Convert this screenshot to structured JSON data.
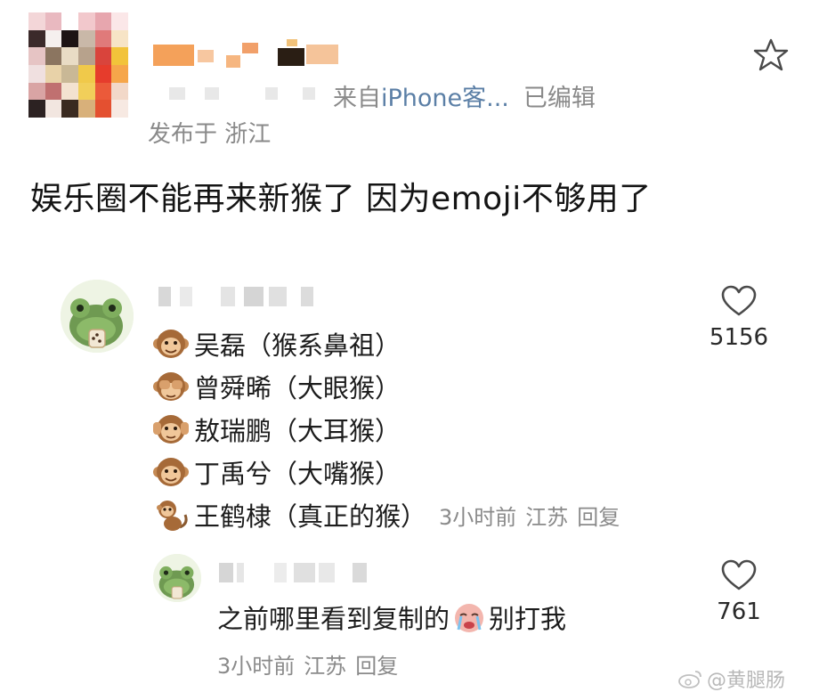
{
  "post": {
    "source_prefix": "来自",
    "source_text": "iPhone客...",
    "edited": "已编辑",
    "location": "发布于 浙江",
    "body": "娱乐圈不能再来新猴了 因为emoji不够用了",
    "star_icon": "star-outline-icon"
  },
  "comments": [
    {
      "avatar_icon": "frog-avatar-icon",
      "lines": [
        {
          "emoji": "monkey-face",
          "text": "吴磊（猴系鼻祖）"
        },
        {
          "emoji": "see-no-evil-monkey",
          "text": "曾舜晞（大眼猴）"
        },
        {
          "emoji": "hear-no-evil-monkey",
          "text": "敖瑞鹏（大耳猴）"
        },
        {
          "emoji": "monkey-face",
          "text": "丁禹兮（大嘴猴）"
        },
        {
          "emoji": "monkey",
          "text": "王鹤棣（真正的猴）"
        }
      ],
      "time": "3小时前",
      "region": "江苏",
      "reply_label": "回复",
      "likes": "5156"
    },
    {
      "avatar_icon": "frog-avatar-icon",
      "text_before": "之前哪里看到复制的",
      "emoji": "crying-face",
      "text_after": "别打我",
      "time": "3小时前",
      "region": "江苏",
      "reply_label": "回复",
      "likes": "761"
    }
  ],
  "watermark": "@黄腿肠",
  "colors": {
    "meta_gray": "#8a8a8a",
    "source_blue": "#5b7fa6",
    "text": "#1c1c1c"
  }
}
